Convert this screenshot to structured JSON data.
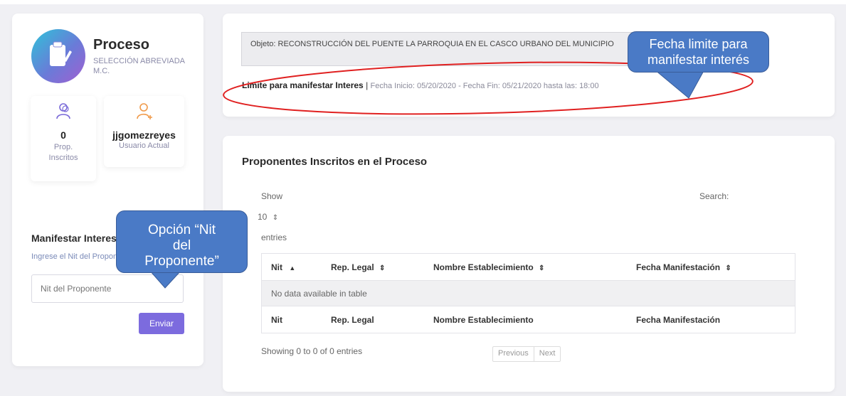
{
  "process": {
    "title": "Proceso",
    "subtitle": "SELECCIÓN ABREVIADA M.C.",
    "proponents_count": "0",
    "proponents_label": "Prop. Inscritos",
    "username": "jjgomezreyes",
    "user_label": "Usuario Actual"
  },
  "manifest": {
    "title": "Manifestar Interes",
    "subtitle": "Ingrese el Nit del Proponente",
    "input_placeholder": "Nit del Proponente",
    "submit_label": "Enviar"
  },
  "objeto": {
    "text": "Objeto: RECONSTRUCCIÓN DEL PUENTE LA PARROQUIA EN EL CASCO URBANO DEL MUNICIPIO"
  },
  "limite": {
    "label": "Limite para manifestar Interes",
    "separator": "|",
    "dates": "Fecha Inicio: 05/20/2020 - Fecha Fin: 05/21/2020 hasta las: 18:00"
  },
  "table_section": {
    "title": "Proponentes Inscritos en el Proceso",
    "show_label": "Show",
    "page_size": "10",
    "entries_label": "entries",
    "search_label": "Search:",
    "columns": [
      "Nit",
      "Rep. Legal",
      "Nombre Establecimiento",
      "Fecha Manifestación"
    ],
    "empty_message": "No data available in table",
    "info": "Showing 0 to 0 of 0 entries",
    "prev_label": "Previous",
    "next_label": "Next"
  },
  "annotations": {
    "callout_fecha": "Fecha limite para manifestar interés",
    "callout_nit": "Opción “Nit del Proponente”",
    "highlight_color": "#e02020",
    "callout_color": "#4a7ac6"
  },
  "colors": {
    "accent": "#7c6bde",
    "icon_purple": "#7a6ad8",
    "icon_orange": "#f09a4a"
  }
}
